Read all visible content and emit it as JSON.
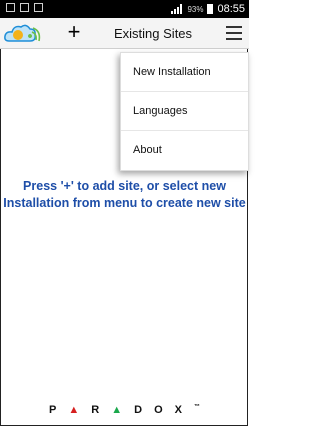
{
  "status_bar": {
    "battery_percent": "93%",
    "time": "08:55"
  },
  "app_bar": {
    "logo_icon": "cloud-wifi-logo-icon",
    "add_label": "+",
    "title": "Existing Sites",
    "menu_icon": "hamburger-menu-icon"
  },
  "menu": {
    "items": [
      {
        "label": "New Installation"
      },
      {
        "label": "Languages"
      },
      {
        "label": "About"
      }
    ]
  },
  "message": {
    "text": "Press '+' to add site, or select new Installation from menu to create new site"
  },
  "footer": {
    "brand_letters": [
      "P",
      "▲",
      "R",
      "▲",
      "D",
      "O",
      "X"
    ],
    "trademark": "™"
  },
  "colors": {
    "message": "#1e4ea8",
    "brand_red": "#d62020",
    "brand_green": "#1aa84c"
  }
}
